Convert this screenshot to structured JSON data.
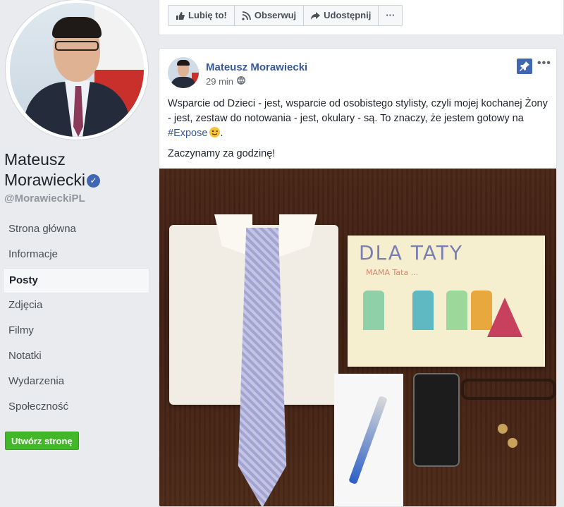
{
  "sidebar": {
    "page_name": "Mateusz Morawiecki",
    "handle": "@MorawieckiPL",
    "nav": [
      {
        "label": "Strona główna",
        "active": false
      },
      {
        "label": "Informacje",
        "active": false
      },
      {
        "label": "Posty",
        "active": true
      },
      {
        "label": "Zdjęcia",
        "active": false
      },
      {
        "label": "Filmy",
        "active": false
      },
      {
        "label": "Notatki",
        "active": false
      },
      {
        "label": "Wydarzenia",
        "active": false
      },
      {
        "label": "Społeczność",
        "active": false
      }
    ],
    "create_page_label": "Utwórz stronę"
  },
  "action_bar": {
    "like_label": "Lubię to!",
    "follow_label": "Obserwuj",
    "share_label": "Udostępnij",
    "more_label": "···"
  },
  "post": {
    "author": "Mateusz Morawiecki",
    "time": "29 min",
    "more_label": "•••",
    "text_line1": "Wsparcie od Dzieci - jest, wsparcie od osobistego stylisty, czyli mojej kochanej Żony - jest, zestaw do notowania - jest, okulary - są. To znaczy, że jestem gotowy na ",
    "hashtag": "#Expose",
    "text_line2": "Zaczynamy za godzinę!",
    "photo": {
      "drawing_title": "DLA TATY",
      "drawing_sub": "MAMA  Tata  ..."
    }
  },
  "colors": {
    "brand_blue": "#4267b2",
    "link_blue": "#365899",
    "create_green": "#42b72a"
  }
}
